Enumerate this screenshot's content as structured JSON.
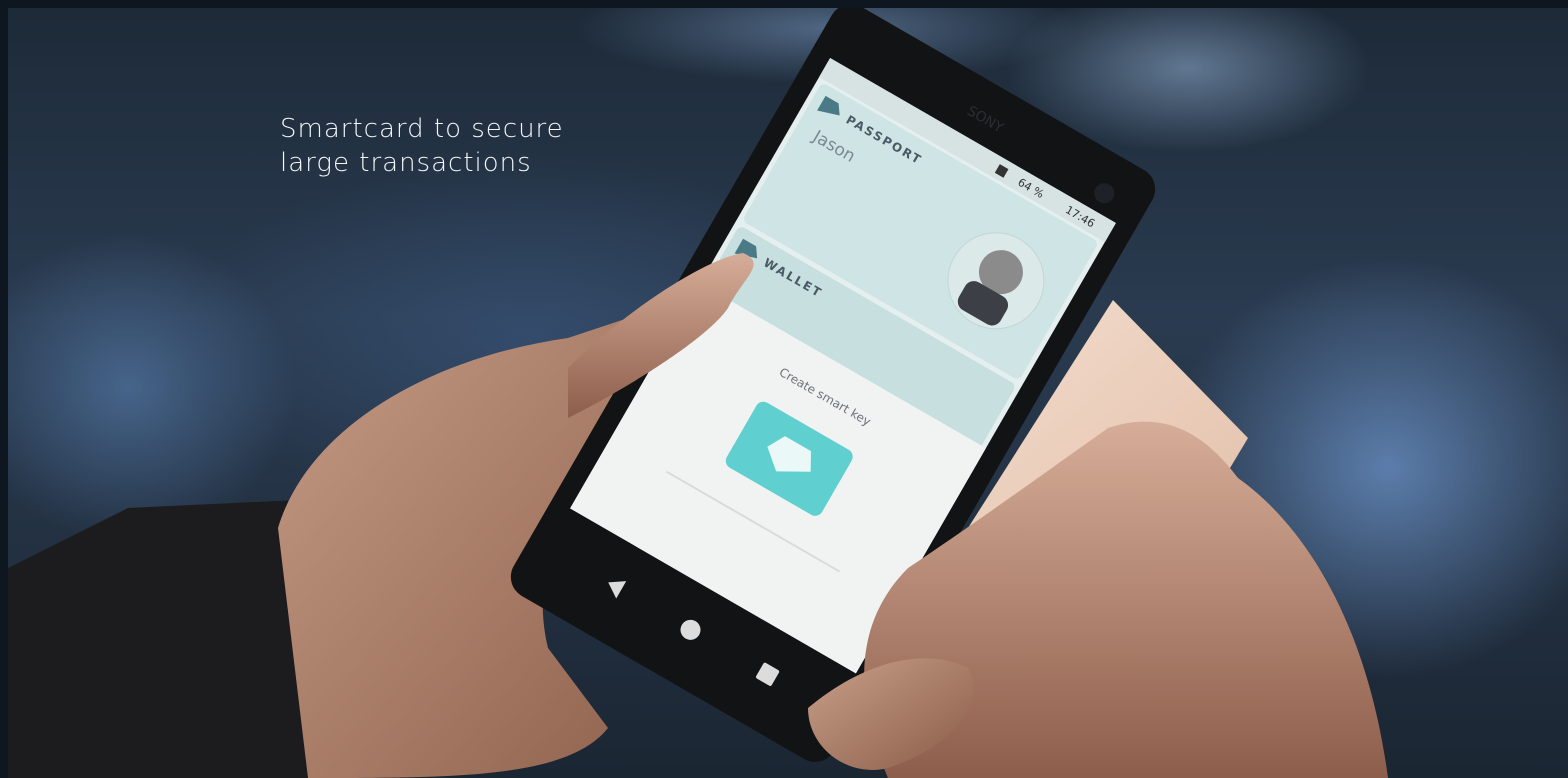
{
  "caption": {
    "line1": "Smartcard to secure",
    "line2": "large transactions"
  },
  "phone": {
    "brand": "SONY",
    "status": {
      "battery": "64 %",
      "time": "17:46"
    },
    "passport_card": {
      "label": "PASSPORT",
      "name": "Jason"
    },
    "wallet_card": {
      "label": "WALLET"
    },
    "sheet_text": "Create smart key"
  },
  "icons": [
    "app-logo-icon",
    "nfc-icon",
    "back-icon",
    "home-icon",
    "recents-icon",
    "card-icon"
  ],
  "colors": {
    "accent": "#5fcfcf",
    "screen": "#dfeeee"
  }
}
